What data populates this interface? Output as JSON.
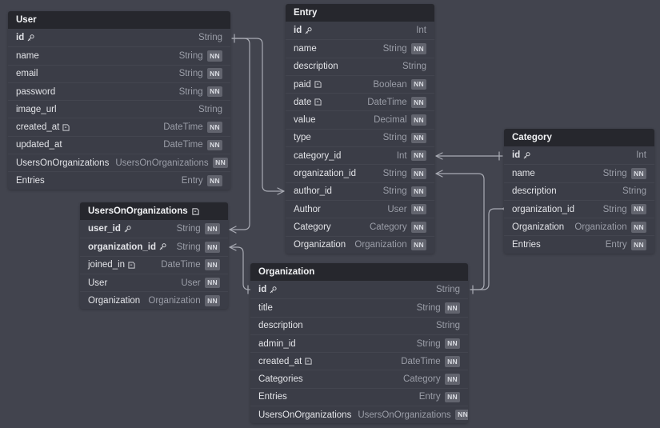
{
  "diagram": {
    "kind": "database-schema-erd",
    "background_color": "#42444e",
    "header_color": "#26272d",
    "row_color": "#3b3d47",
    "accent_text_color": "#9b9ea8",
    "badge_color": "#62646e",
    "badge_label": "NN"
  },
  "tables": [
    {
      "name": "User",
      "header_icon": "",
      "fields": [
        {
          "name": "id",
          "icon": "key-icon",
          "type": "String",
          "nn": false,
          "pk": true
        },
        {
          "name": "name",
          "icon": "",
          "type": "String",
          "nn": true,
          "pk": false
        },
        {
          "name": "email",
          "icon": "",
          "type": "String",
          "nn": true,
          "pk": false
        },
        {
          "name": "password",
          "icon": "",
          "type": "String",
          "nn": true,
          "pk": false
        },
        {
          "name": "image_url",
          "icon": "",
          "type": "String",
          "nn": false,
          "pk": false
        },
        {
          "name": "created_at",
          "icon": "default-icon",
          "type": "DateTime",
          "nn": true,
          "pk": false
        },
        {
          "name": "updated_at",
          "icon": "",
          "type": "DateTime",
          "nn": true,
          "pk": false
        },
        {
          "name": "UsersOnOrganizations",
          "icon": "",
          "type": "UsersOnOrganizations",
          "nn": true,
          "pk": false
        },
        {
          "name": "Entries",
          "icon": "",
          "type": "Entry",
          "nn": true,
          "pk": false
        }
      ]
    },
    {
      "name": "Entry",
      "header_icon": "",
      "fields": [
        {
          "name": "id",
          "icon": "key-icon",
          "type": "Int",
          "nn": false,
          "pk": true
        },
        {
          "name": "name",
          "icon": "",
          "type": "String",
          "nn": true,
          "pk": false
        },
        {
          "name": "description",
          "icon": "",
          "type": "String",
          "nn": false,
          "pk": false
        },
        {
          "name": "paid",
          "icon": "default-icon",
          "type": "Boolean",
          "nn": true,
          "pk": false
        },
        {
          "name": "date",
          "icon": "default-icon",
          "type": "DateTime",
          "nn": true,
          "pk": false
        },
        {
          "name": "value",
          "icon": "",
          "type": "Decimal",
          "nn": true,
          "pk": false
        },
        {
          "name": "type",
          "icon": "",
          "type": "String",
          "nn": true,
          "pk": false
        },
        {
          "name": "category_id",
          "icon": "",
          "type": "Int",
          "nn": true,
          "pk": false
        },
        {
          "name": "organization_id",
          "icon": "",
          "type": "String",
          "nn": true,
          "pk": false
        },
        {
          "name": "author_id",
          "icon": "",
          "type": "String",
          "nn": true,
          "pk": false
        },
        {
          "name": "Author",
          "icon": "",
          "type": "User",
          "nn": true,
          "pk": false
        },
        {
          "name": "Category",
          "icon": "",
          "type": "Category",
          "nn": true,
          "pk": false
        },
        {
          "name": "Organization",
          "icon": "",
          "type": "Organization",
          "nn": true,
          "pk": false
        }
      ]
    },
    {
      "name": "Category",
      "header_icon": "",
      "fields": [
        {
          "name": "id",
          "icon": "key-icon",
          "type": "Int",
          "nn": false,
          "pk": true
        },
        {
          "name": "name",
          "icon": "",
          "type": "String",
          "nn": true,
          "pk": false
        },
        {
          "name": "description",
          "icon": "",
          "type": "String",
          "nn": false,
          "pk": false
        },
        {
          "name": "organization_id",
          "icon": "",
          "type": "String",
          "nn": true,
          "pk": false
        },
        {
          "name": "Organization",
          "icon": "",
          "type": "Organization",
          "nn": true,
          "pk": false
        },
        {
          "name": "Entries",
          "icon": "",
          "type": "Entry",
          "nn": true,
          "pk": false
        }
      ]
    },
    {
      "name": "UsersOnOrganizations",
      "header_icon": "default-icon",
      "fields": [
        {
          "name": "user_id",
          "icon": "key-icon",
          "type": "String",
          "nn": true,
          "pk": true
        },
        {
          "name": "organization_id",
          "icon": "key-icon",
          "type": "String",
          "nn": true,
          "pk": true
        },
        {
          "name": "joined_in",
          "icon": "default-icon",
          "type": "DateTime",
          "nn": true,
          "pk": false
        },
        {
          "name": "User",
          "icon": "",
          "type": "User",
          "nn": true,
          "pk": false
        },
        {
          "name": "Organization",
          "icon": "",
          "type": "Organization",
          "nn": true,
          "pk": false
        }
      ]
    },
    {
      "name": "Organization",
      "header_icon": "",
      "fields": [
        {
          "name": "id",
          "icon": "key-icon",
          "type": "String",
          "nn": false,
          "pk": true
        },
        {
          "name": "title",
          "icon": "",
          "type": "String",
          "nn": true,
          "pk": false
        },
        {
          "name": "description",
          "icon": "",
          "type": "String",
          "nn": false,
          "pk": false
        },
        {
          "name": "admin_id",
          "icon": "",
          "type": "String",
          "nn": true,
          "pk": false
        },
        {
          "name": "created_at",
          "icon": "default-icon",
          "type": "DateTime",
          "nn": true,
          "pk": false
        },
        {
          "name": "Categories",
          "icon": "",
          "type": "Category",
          "nn": true,
          "pk": false
        },
        {
          "name": "Entries",
          "icon": "",
          "type": "Entry",
          "nn": true,
          "pk": false
        },
        {
          "name": "UsersOnOrganizations",
          "icon": "",
          "type": "UsersOnOrganizations",
          "nn": true,
          "pk": false
        }
      ]
    }
  ],
  "relations": [
    {
      "from": "Entry.author_id",
      "to": "User.id",
      "kind": "many-to-one"
    },
    {
      "from": "UsersOnOrganizations.user_id",
      "to": "User.id",
      "kind": "many-to-one"
    },
    {
      "from": "Entry.category_id",
      "to": "Category.id",
      "kind": "many-to-one"
    },
    {
      "from": "Entry.organization_id",
      "to": "Organization.id",
      "kind": "many-to-one"
    },
    {
      "from": "Category.organization_id",
      "to": "Organization.id",
      "kind": "many-to-one"
    },
    {
      "from": "UsersOnOrganizations.organization_id",
      "to": "Organization.id",
      "kind": "many-to-one"
    }
  ]
}
